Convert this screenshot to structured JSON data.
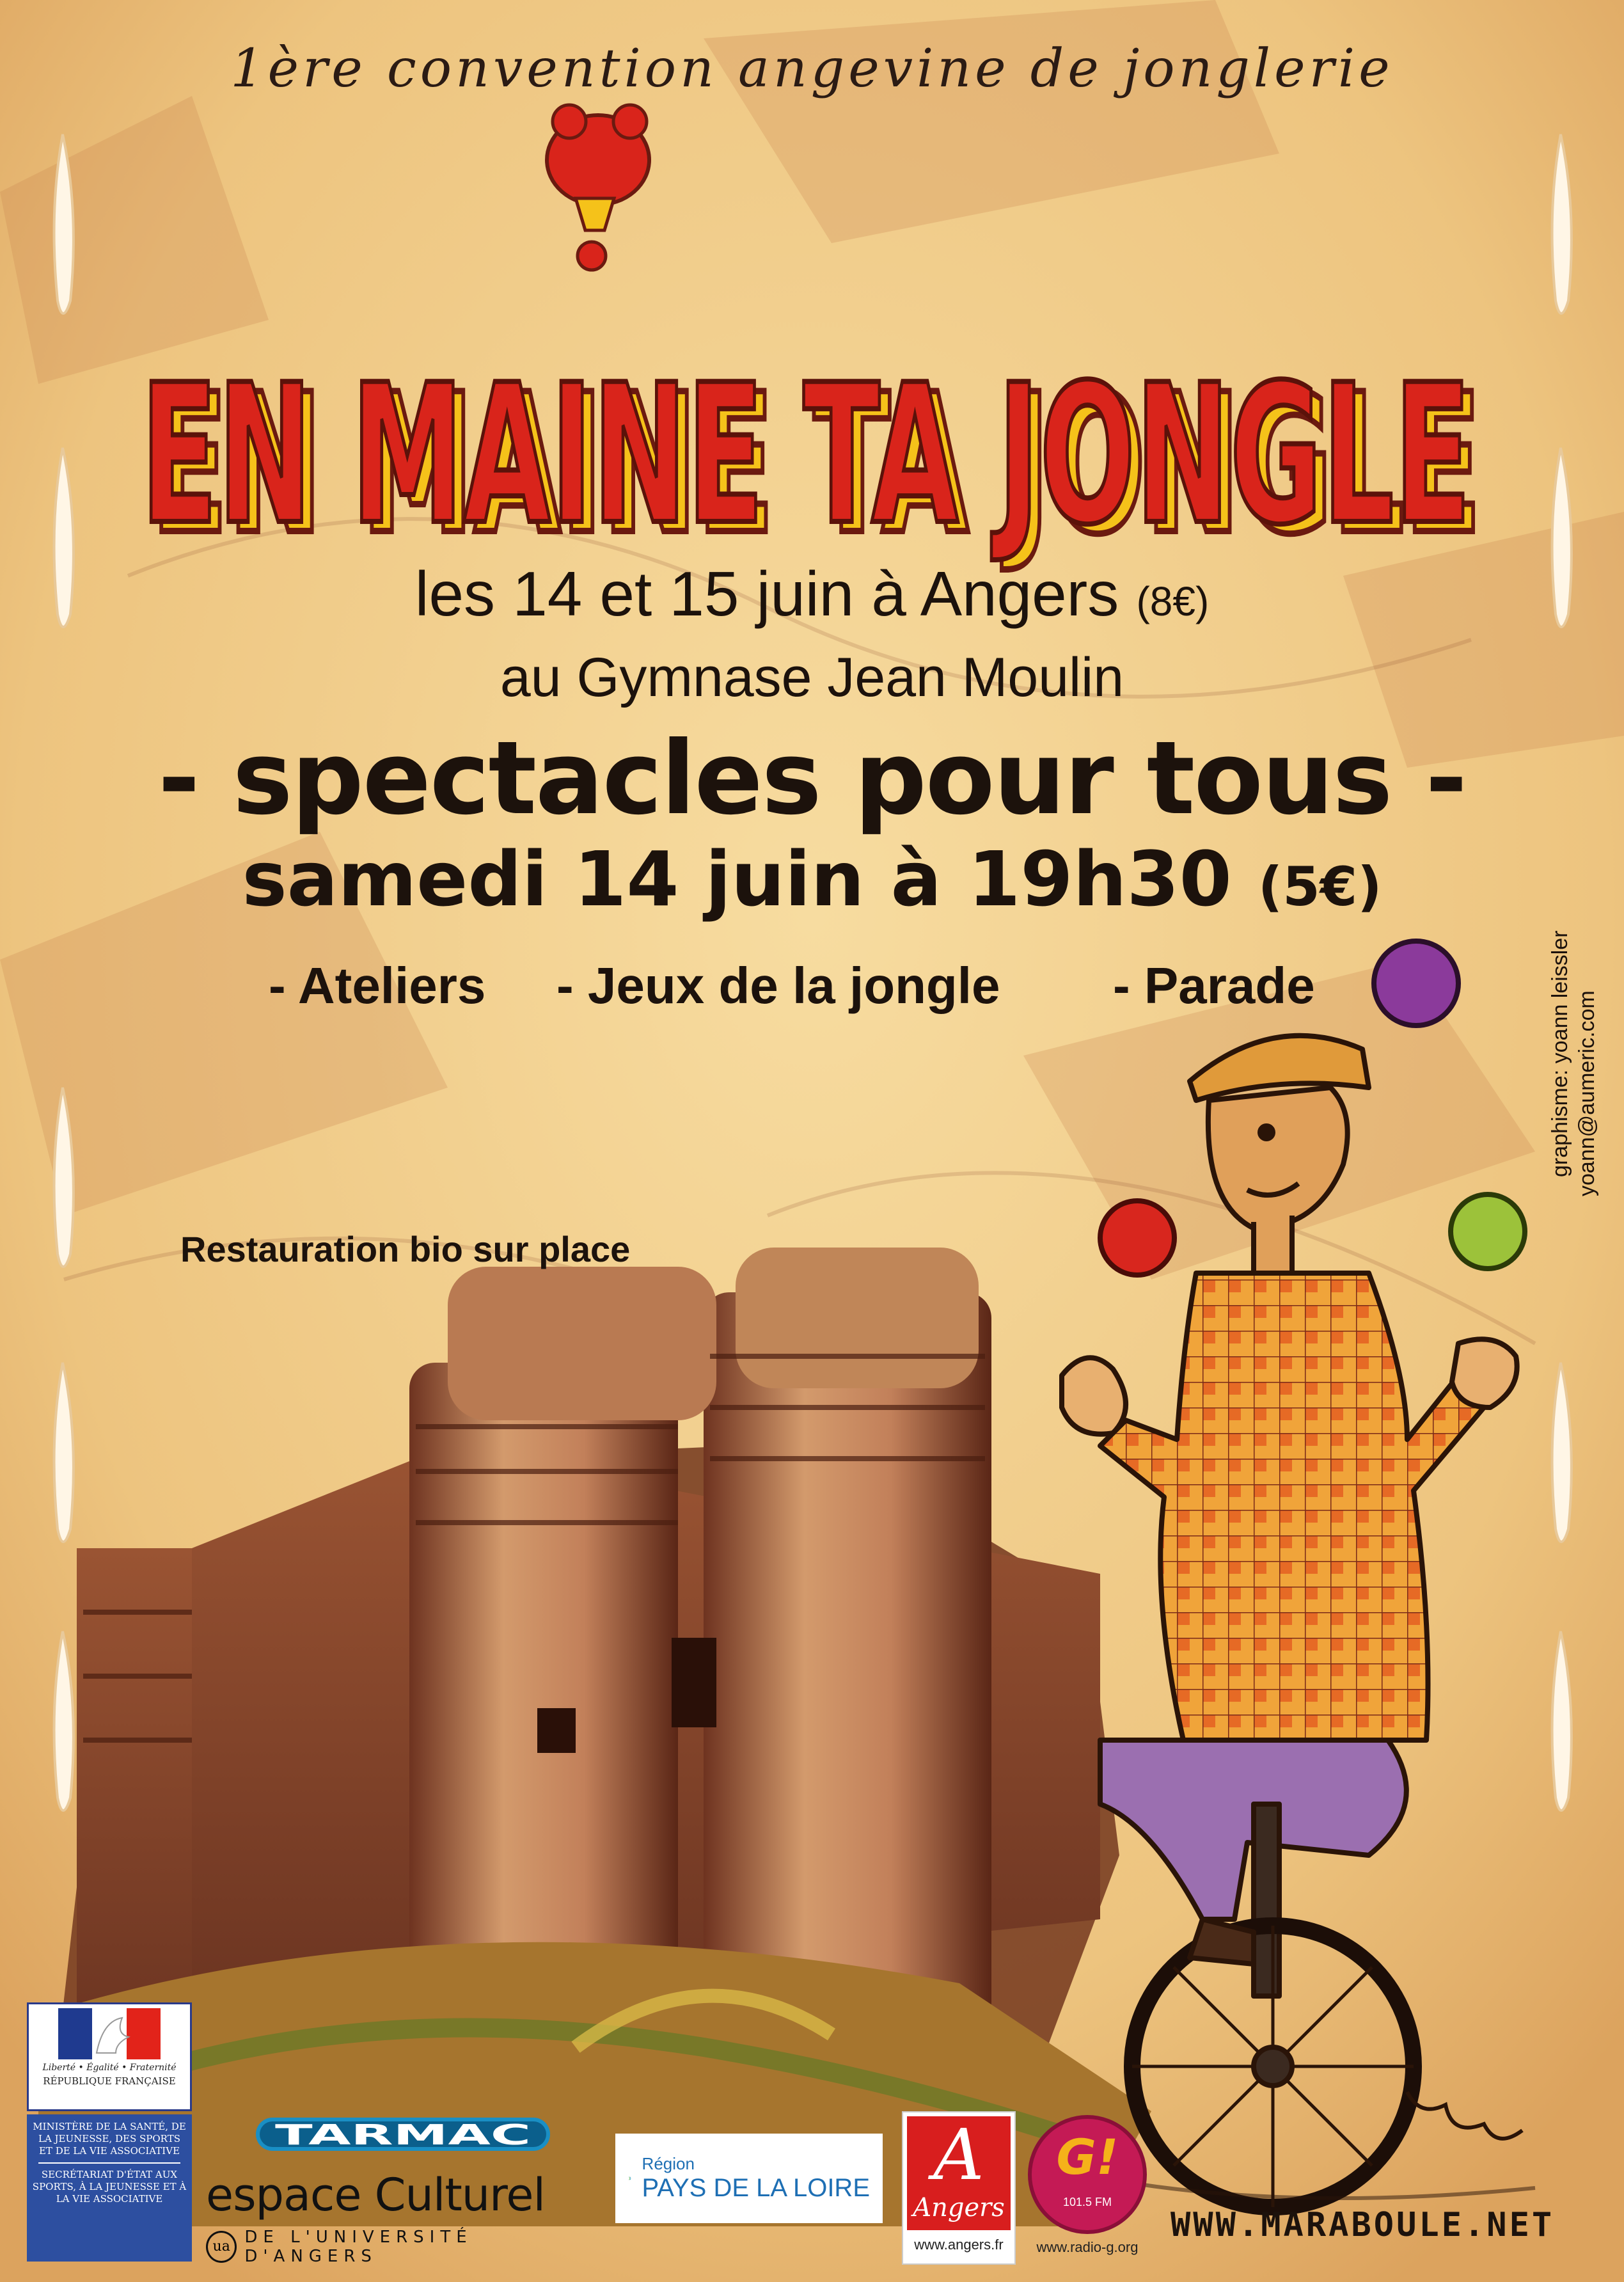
{
  "header": {
    "tagline": "1ère convention angevine de jonglerie"
  },
  "title": {
    "text": "EN MAINE TA JONGLE"
  },
  "event": {
    "dates_place": "les 14 et 15 juin à Angers",
    "dates_price": "(8€)",
    "venue": "au Gymnase Jean Moulin",
    "shows_heading": "- spectacles pour tous -",
    "show_datetime": "samedi 14 juin à 19h30",
    "show_price": "(5€)",
    "activities": [
      "- Ateliers",
      "- Jeux de la jongle",
      "- Parade"
    ],
    "food": "Restauration bio sur place"
  },
  "credits": {
    "line1": "graphisme: yoann leissler",
    "line2": "yoann@aumeric.com"
  },
  "sponsors": {
    "republique": {
      "motto": "Liberté • Égalité • Fraternité",
      "name": "RÉPUBLIQUE FRANÇAISE"
    },
    "ministere": {
      "text1": "MINISTÈRE DE LA SANTÉ, DE LA JEUNESSE, DES SPORTS ET DE LA VIE ASSOCIATIVE",
      "text2": "SECRÉTARIAT D'ÉTAT AUX SPORTS, À LA JEUNESSE ET À LA VIE ASSOCIATIVE"
    },
    "tarmac": "TARMAC",
    "espace_culturel": {
      "name": "espace Culturel",
      "sub": "DE L'UNIVERSITÉ D'ANGERS",
      "badge": "ua"
    },
    "region": {
      "label": "Région",
      "name": "PAYS DE LA LOIRE"
    },
    "angers": {
      "letter": "A",
      "name": "Angers",
      "url": "www.angers.fr"
    },
    "radio": {
      "letter": "G!",
      "freq": "101.5 FM",
      "url": "www.radio-g.org"
    }
  },
  "footer": {
    "website": "WWW.MARABOULE.NET"
  },
  "colors": {
    "background": "#f1cf8e",
    "title_red": "#d9241b",
    "title_yellow": "#f5c21a",
    "ball_purple": "#8b3a9b",
    "ball_red": "#d8261e",
    "ball_green": "#9cc23a"
  }
}
